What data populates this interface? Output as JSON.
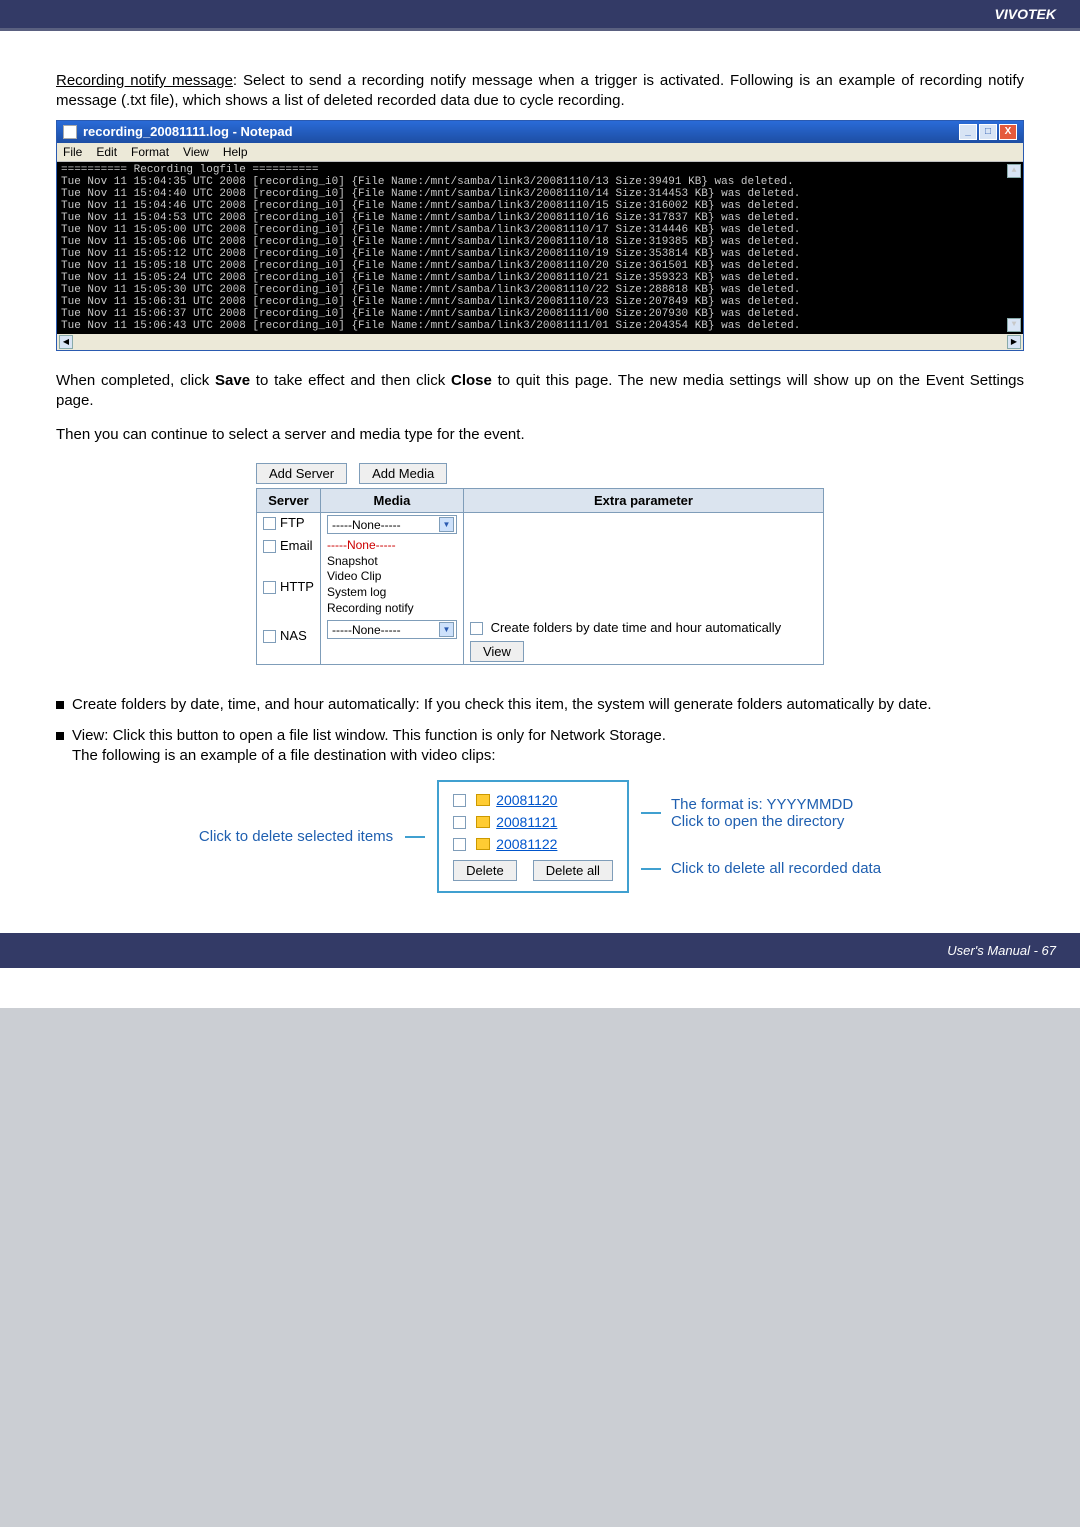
{
  "brand": "VIVOTEK",
  "intro": {
    "heading": "Recording notify message",
    "text": ": Select to send a recording notify message when a trigger is activated. Following is an example of recording notify message (.txt file), which shows a list of deleted recorded data due to cycle recording."
  },
  "notepad": {
    "title": "recording_20081111.log - Notepad",
    "menu": [
      "File",
      "Edit",
      "Format",
      "View",
      "Help"
    ],
    "header": "========== Recording logfile ==========",
    "lines": [
      "Tue Nov 11 15:04:35 UTC 2008 [recording_i0] {File Name:/mnt/samba/link3/20081110/13 Size:39491 KB} was deleted.",
      "Tue Nov 11 15:04:40 UTC 2008 [recording_i0] {File Name:/mnt/samba/link3/20081110/14 Size:314453 KB} was deleted.",
      "Tue Nov 11 15:04:46 UTC 2008 [recording_i0] {File Name:/mnt/samba/link3/20081110/15 Size:316002 KB} was deleted.",
      "Tue Nov 11 15:04:53 UTC 2008 [recording_i0] {File Name:/mnt/samba/link3/20081110/16 Size:317837 KB} was deleted.",
      "Tue Nov 11 15:05:00 UTC 2008 [recording_i0] {File Name:/mnt/samba/link3/20081110/17 Size:314446 KB} was deleted.",
      "Tue Nov 11 15:05:06 UTC 2008 [recording_i0] {File Name:/mnt/samba/link3/20081110/18 Size:319385 KB} was deleted.",
      "Tue Nov 11 15:05:12 UTC 2008 [recording_i0] {File Name:/mnt/samba/link3/20081110/19 Size:353814 KB} was deleted.",
      "Tue Nov 11 15:05:18 UTC 2008 [recording_i0] {File Name:/mnt/samba/link3/20081110/20 Size:361501 KB} was deleted.",
      "Tue Nov 11 15:05:24 UTC 2008 [recording_i0] {File Name:/mnt/samba/link3/20081110/21 Size:359323 KB} was deleted.",
      "Tue Nov 11 15:05:30 UTC 2008 [recording_i0] {File Name:/mnt/samba/link3/20081110/22 Size:288818 KB} was deleted.",
      "Tue Nov 11 15:06:31 UTC 2008 [recording_i0] {File Name:/mnt/samba/link3/20081110/23 Size:207849 KB} was deleted.",
      "Tue Nov 11 15:06:37 UTC 2008 [recording_i0] {File Name:/mnt/samba/link3/20081111/00 Size:207930 KB} was deleted.",
      "Tue Nov 11 15:06:43 UTC 2008 [recording_i0] {File Name:/mnt/samba/link3/20081111/01 Size:204354 KB} was deleted."
    ]
  },
  "after_notepad_1": {
    "pre": "When completed, click ",
    "save": "Save",
    "mid": " to take effect and then click ",
    "close": "Close",
    "post": " to quit this page. The new media settings will show up on the Event Settings page."
  },
  "after_notepad_2": "Then you can continue to select a server and media type for the event.",
  "evtable": {
    "add_server": "Add Server",
    "add_media": "Add Media",
    "headers": [
      "Server",
      "Media",
      "Extra parameter"
    ],
    "rows": {
      "ftp": "FTP",
      "email": "Email",
      "http": "HTTP",
      "nas": "NAS"
    },
    "none": "-----None-----",
    "media_options": [
      "-----None-----",
      "Snapshot",
      "Video Clip",
      "System log",
      "Recording notify"
    ],
    "extra_checkbox": "Create folders by date time and hour automatically",
    "view_btn": "View"
  },
  "bullets": {
    "b1": "Create folders by date, time, and hour automatically: If you check this item, the system will generate folders automatically by date.",
    "b2": "View: Click this button to open a file list window. This function is only for Network Storage.",
    "b2_sub": "The following is an example of a file destination with video clips:"
  },
  "diagram": {
    "left_label": "Click to delete selected items",
    "dirs": [
      "20081120",
      "20081121",
      "20081122"
    ],
    "delete": "Delete",
    "delete_all": "Delete all",
    "right_top": "The format is: YYYYMMDD",
    "right_top2": "Click to open the directory",
    "right_bottom": "Click to delete all recorded data"
  },
  "footer": "User's Manual - 67"
}
